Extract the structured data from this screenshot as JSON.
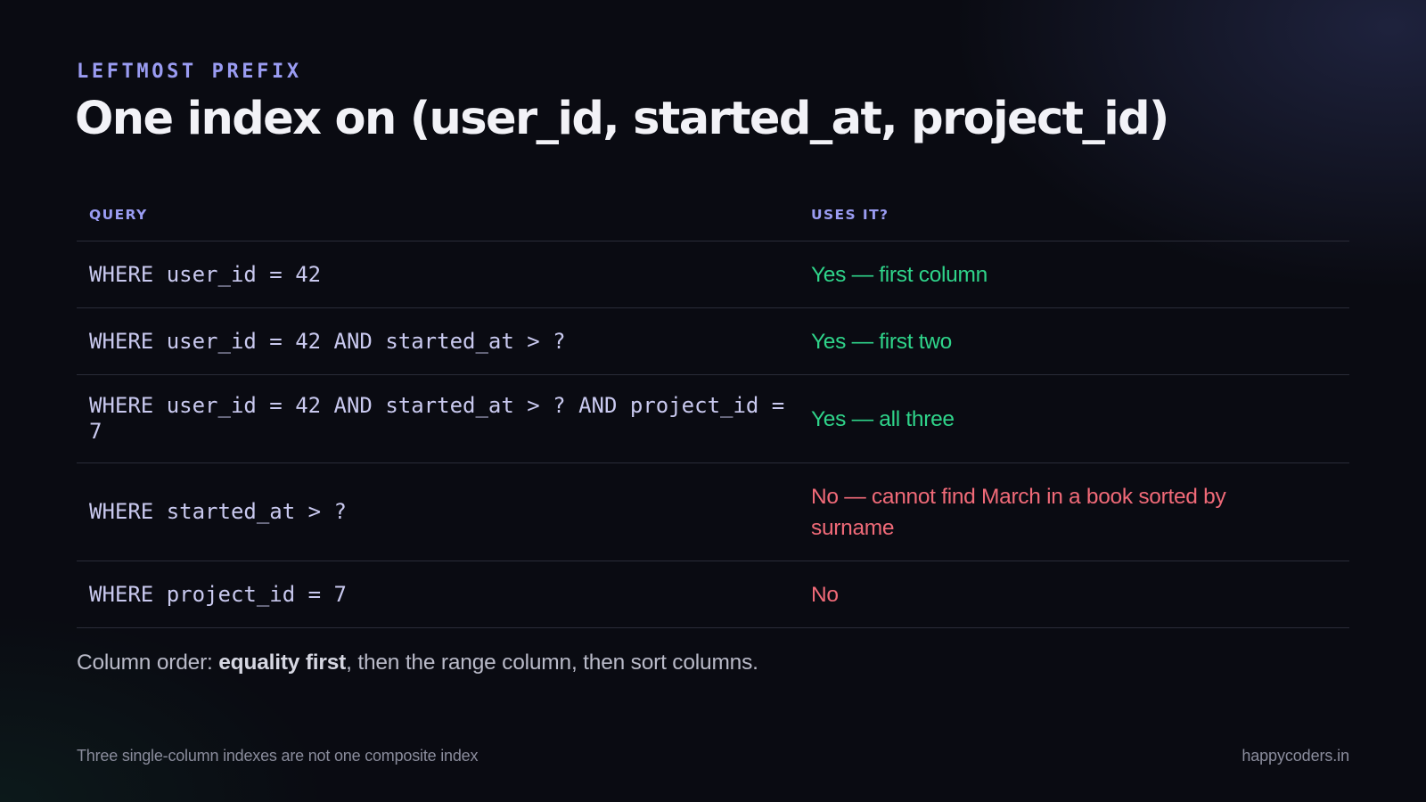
{
  "slide": {
    "eyebrow": "LEFTMOST PREFIX",
    "title": "One index on (user_id, started_at, project_id)"
  },
  "table": {
    "headers": {
      "query": "QUERY",
      "uses": "USES IT?"
    },
    "rows": [
      {
        "query": "WHERE user_id = 42",
        "uses": "Yes — first column",
        "status": "yes"
      },
      {
        "query": "WHERE user_id = 42 AND started_at > ?",
        "uses": "Yes — first two",
        "status": "yes"
      },
      {
        "query": "WHERE user_id = 42 AND started_at > ? AND project_id = 7",
        "uses": "Yes — all three",
        "status": "yes"
      },
      {
        "query": "WHERE started_at > ?",
        "uses": "No — cannot find March in a book sorted by surname",
        "status": "no"
      },
      {
        "query": "WHERE project_id = 7",
        "uses": "No",
        "status": "no"
      }
    ]
  },
  "note": {
    "prefix": "Column order: ",
    "emphasis": "equality first",
    "suffix": ", then the range column, then sort columns."
  },
  "footer": {
    "left": "Three single-column indexes are not one composite index",
    "right": "happycoders.in"
  },
  "colors": {
    "background": "#0a0b12",
    "accent": "#9a9cf2",
    "yes": "#2fd48a",
    "no": "#f06a78",
    "code": "#c9c9ef"
  }
}
